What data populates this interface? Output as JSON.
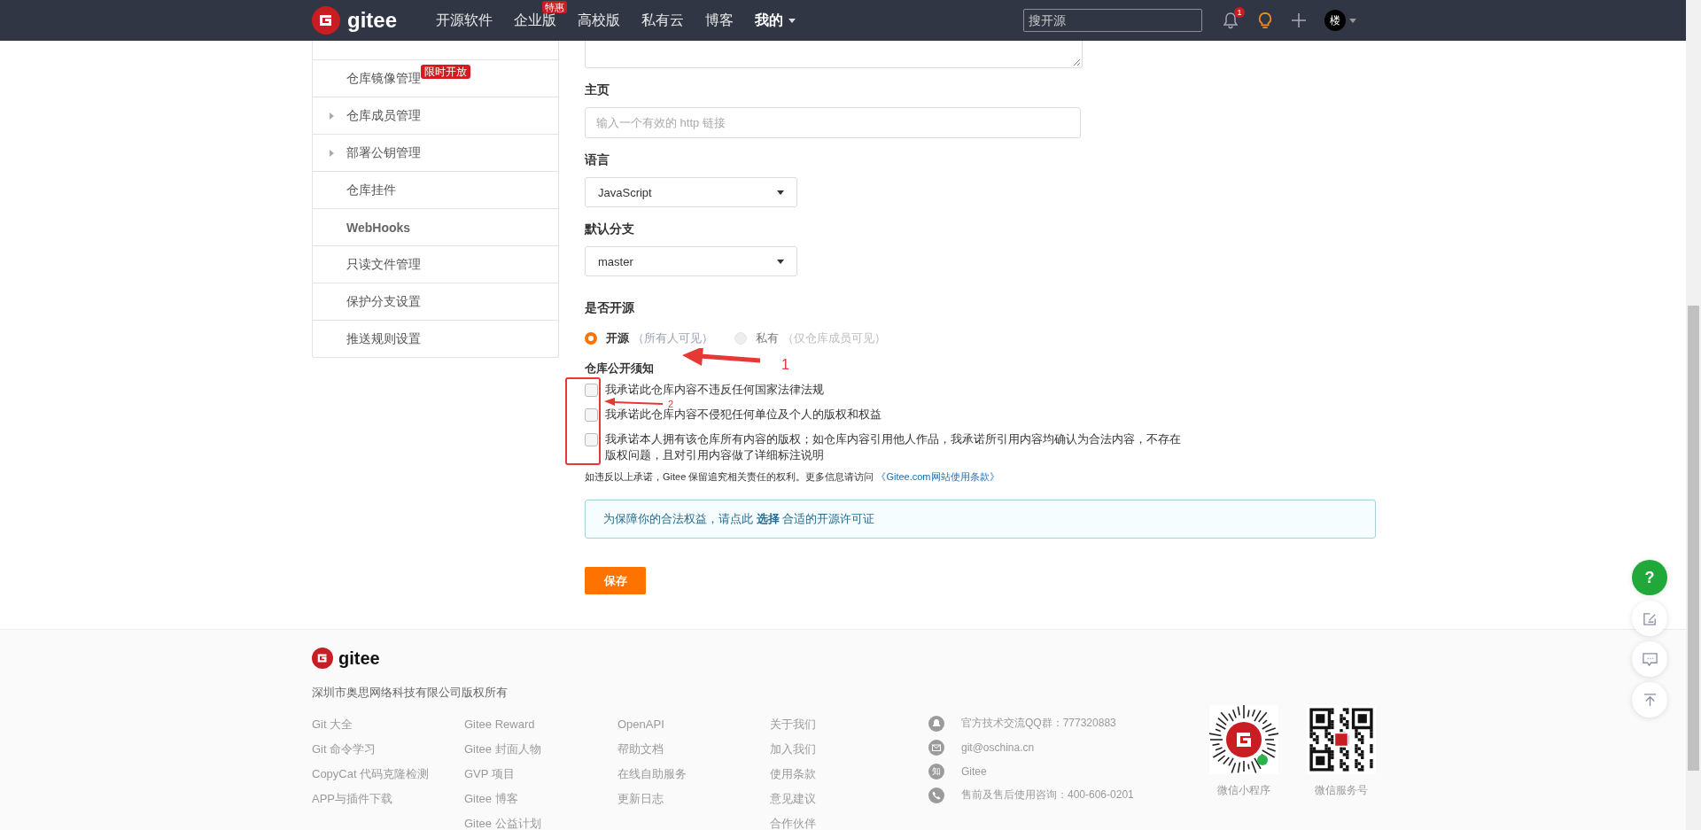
{
  "navbar": {
    "logo": "gitee",
    "items": [
      {
        "label": "开源软件"
      },
      {
        "label": "企业版",
        "badge": "特惠"
      },
      {
        "label": "高校版"
      },
      {
        "label": "私有云"
      },
      {
        "label": "博客"
      },
      {
        "label": "我的",
        "dropdown": true
      }
    ],
    "search": {
      "placeholder": "搜开源"
    },
    "notification_count": "1",
    "avatar": "楼"
  },
  "sidebar": {
    "items": [
      {
        "label": "仓库镜像管理",
        "badge": "限时开放",
        "expandable": false
      },
      {
        "label": "仓库成员管理",
        "expandable": true
      },
      {
        "label": "部署公钥管理",
        "expandable": true
      },
      {
        "label": "仓库挂件",
        "expandable": false
      },
      {
        "label": "WebHooks",
        "expandable": false
      },
      {
        "label": "只读文件管理",
        "expandable": false
      },
      {
        "label": "保护分支设置",
        "expandable": false
      },
      {
        "label": "推送规则设置",
        "expandable": false
      }
    ]
  },
  "form": {
    "fields": [
      {
        "kind": "textarea"
      },
      {
        "kind": "input",
        "label": "主页",
        "placeholder": "输入一个有效的 http 链接"
      },
      {
        "kind": "select",
        "label": "语言",
        "value": "JavaScript"
      },
      {
        "kind": "select",
        "label": "默认分支",
        "value": "master"
      }
    ],
    "visibility": {
      "label": "是否开源",
      "options": [
        {
          "label": "开源",
          "hint": "（所有人可见）",
          "selected": true,
          "disabled": false
        },
        {
          "label": "私有",
          "hint": "（仅仓库成员可见）",
          "selected": false,
          "disabled": true
        }
      ]
    },
    "notice": {
      "title": "仓库公开须知",
      "checks": [
        {
          "label": "我承诺此仓库内容不违反任何国家法律法规",
          "checked": false
        },
        {
          "label": "我承诺此仓库内容不侵犯任何单位及个人的版权和权益",
          "checked": false
        },
        {
          "label": "我承诺本人拥有该仓库所有内容的版权；如仓库内容引用他人作品，我承诺所引用内容均确认为合法内容，不存在版权问题，且对引用内容做了详细标注说明",
          "checked": false
        }
      ],
      "disclaimer": "如违反以上承诺，Gitee 保留追究相关责任的权利。更多信息请访问",
      "link": "《Gitee.com网站使用条款》"
    },
    "license_tip": "为保障你的合法权益，请点此 **选择** 合适的开源许可证",
    "save": "保存"
  },
  "footer": {
    "logo": "gitee",
    "copyright": "深圳市奥思网络科技有限公司版权所有",
    "columns": [
      [
        "Git 大全",
        "Git 命令学习",
        "CopyCat 代码克隆检测",
        "APP与插件下载"
      ],
      [
        "Gitee Reward",
        "Gitee 封面人物",
        "GVP 项目",
        "Gitee 博客",
        "Gitee 公益计划"
      ],
      [
        "OpenAPI",
        "帮助文档",
        "在线自助服务",
        "更新日志"
      ],
      [
        "关于我们",
        "加入我们",
        "使用条款",
        "意见建议",
        "合作伙伴"
      ]
    ],
    "contacts": [
      {
        "kind": "qq",
        "text": "官方技术交流QQ群：777320883"
      },
      {
        "kind": "mail",
        "text": "git@oschina.cn"
      },
      {
        "kind": "zhihu",
        "icon": "知",
        "text": "Gitee"
      },
      {
        "kind": "phone",
        "text": "售前及售后使用咨询：400-606-0201"
      }
    ],
    "codes": [
      {
        "kind": "mini",
        "label": "微信小程序"
      },
      {
        "kind": "qr",
        "label": "微信服务号"
      }
    ]
  },
  "float_buttons": [
    {
      "kind": "help",
      "icon": "?"
    },
    {
      "kind": "edit"
    },
    {
      "kind": "chat"
    },
    {
      "kind": "top"
    }
  ],
  "annotations": [
    "1",
    "2"
  ]
}
